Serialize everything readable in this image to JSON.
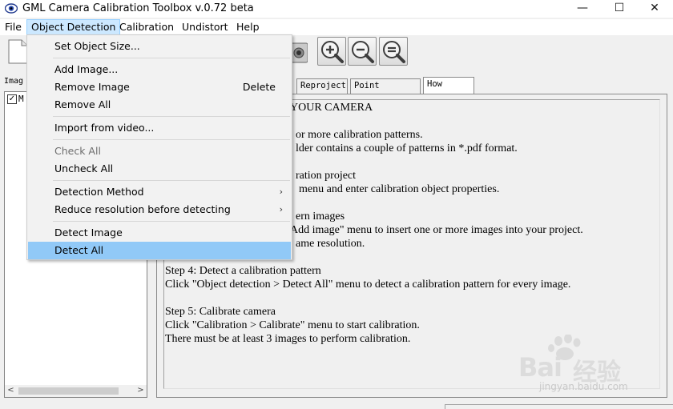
{
  "window": {
    "title": "GML Camera Calibration Toolbox  v.0.72 beta",
    "minimize": "—",
    "maximize": "☐",
    "close": "✕"
  },
  "menubar": {
    "items": [
      {
        "label": "File"
      },
      {
        "label": "Object Detection"
      },
      {
        "label": "Calibration"
      },
      {
        "label": "Undistort"
      },
      {
        "label": "Help"
      }
    ]
  },
  "left_panel": {
    "label": "Imag",
    "item_label": "M",
    "scroll_left": "<",
    "scroll_right": ">"
  },
  "tabs": [
    {
      "label": "Reproject"
    },
    {
      "label": "Point Density"
    },
    {
      "label": "How To..."
    }
  ],
  "howto": {
    "heading": "YOUR CAMERA",
    "line1": "or more calibration patterns.",
    "line2": "lder contains a couple of patterns in *.pdf format.",
    "step2_title": "ration project",
    "step2_text": "menu and enter calibration object properties.",
    "step3_title": "ern images",
    "step3_text": "Add image\"  menu to insert one or more images into your project.",
    "step3_text2": "ame resolution.",
    "step4_title": "Step 4: Detect a calibration pattern",
    "step4_text": "Click  \"Object detection > Detect All\"  menu to detect a calibration pattern for every image.",
    "step5_title": "Step 5: Calibrate camera",
    "step5_text": "Click  \"Calibration > Calibrate\"  menu to start calibration.",
    "step5_text2": "There must be at least 3 images to perform calibration."
  },
  "dropdown": {
    "items": [
      {
        "label": "Set Object Size..."
      },
      {
        "label": "Add Image..."
      },
      {
        "label": "Remove Image",
        "shortcut": "Delete"
      },
      {
        "label": "Remove All"
      },
      {
        "label": "Import from video..."
      },
      {
        "label": "Check All",
        "disabled": true
      },
      {
        "label": "Uncheck All"
      },
      {
        "label": "Detection Method",
        "submenu": "›"
      },
      {
        "label": "Reduce resolution before detecting",
        "submenu": "›"
      },
      {
        "label": "Detect Image"
      },
      {
        "label": "Detect All",
        "highlighted": true
      }
    ]
  },
  "watermark": {
    "brand_left": "Bai",
    "brand_right": "经验",
    "url": "jingyan.baidu.com"
  },
  "colors": {
    "menu_active_bg": "#cce8ff",
    "menu_highlight_bg": "#91c9f7",
    "window_bg": "#f0f0f0"
  }
}
